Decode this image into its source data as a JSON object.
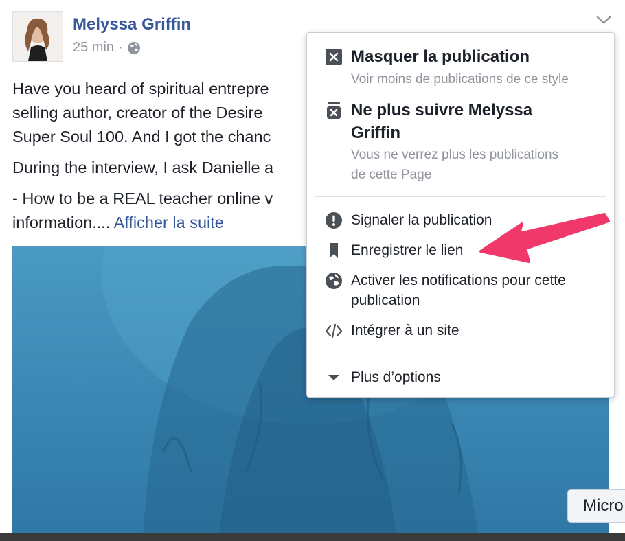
{
  "post": {
    "author": "Melyssa Griffin",
    "time": "25 min",
    "time_separator": "·",
    "text_lines": [
      "Have you heard of spiritual entrepre",
      "selling author, creator of the Desire",
      "Super Soul 100. And I got the chanc",
      "During the interview, I ask Danielle a",
      "- How to be a REAL teacher online v",
      "information...."
    ],
    "see_more": "Afficher la suite"
  },
  "menu": {
    "hide": {
      "title": "Masquer la publication",
      "subtitle": "Voir moins de publications de ce style"
    },
    "unfollow": {
      "title_line1": "Ne plus suivre Melyssa",
      "title_line2": "Griffin",
      "subtitle_line1": "Vous ne verrez plus les publications",
      "subtitle_line2": "de cette Page"
    },
    "report": "Signaler la publication",
    "save_link": "Enregistrer le lien",
    "notifications_line1": "Activer les notifications pour cette",
    "notifications_line2": "publication",
    "embed": "Intégrer à un site",
    "more_options": "Plus d’options"
  },
  "popup_button": "Micro",
  "colors": {
    "link_blue": "#365899",
    "muted_gray": "#90949c",
    "arrow_pink": "#f0386b",
    "photo_blue": "#3a86b3"
  },
  "icons": {
    "avatar": "avatar",
    "globe": "globe-icon",
    "chevron": "chevron-down-icon",
    "hide": "close-box-icon",
    "unfollow": "unfollow-icon",
    "report": "exclamation-icon",
    "save": "bookmark-icon",
    "notifications": "globe-notification-icon",
    "embed": "code-icon",
    "more": "triangle-down-icon"
  }
}
